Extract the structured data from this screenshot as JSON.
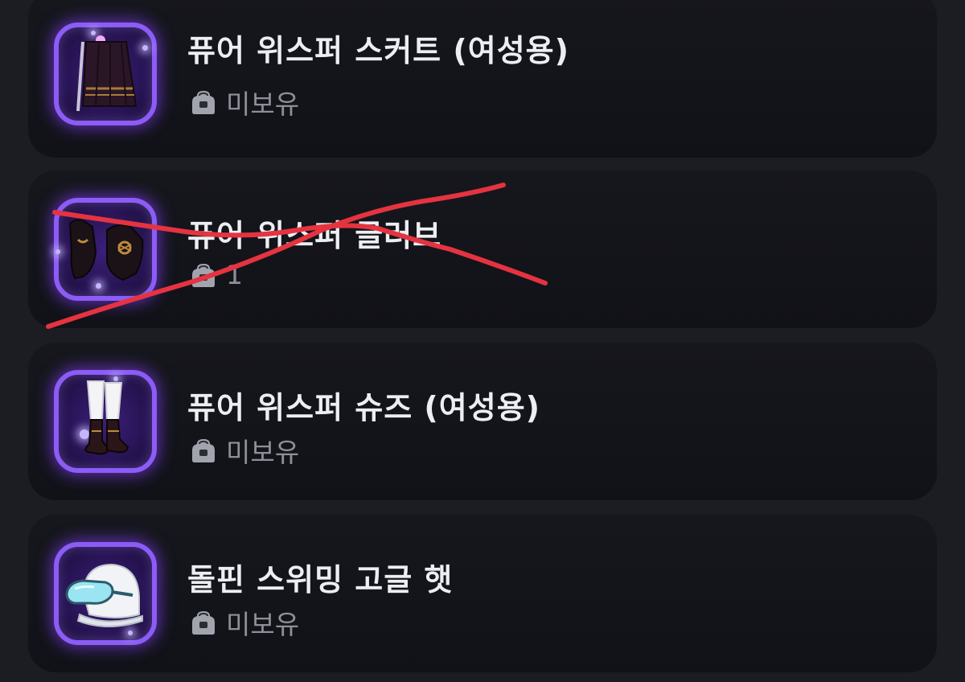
{
  "items": [
    {
      "name": "퓨어 위스퍼 스커트 (여성용)",
      "status": "미보유",
      "icon": "skirt-icon"
    },
    {
      "name": "퓨어 위스퍼 글러브",
      "status": "1",
      "icon": "gloves-icon",
      "crossed_out": true
    },
    {
      "name": "퓨어 위스퍼 슈즈 (여성용)",
      "status": "미보유",
      "icon": "shoes-icon"
    },
    {
      "name": "돌핀 스위밍 고글 햇",
      "status": "미보유",
      "icon": "goggle-hat-icon"
    }
  ],
  "status_icon": "backpack-icon",
  "colors": {
    "background": "#1b1d22",
    "card": "#14151b",
    "rarity_border": "#8b5cf6",
    "name_text": "#eceef2",
    "status_text": "#8d9099",
    "annotation_stroke": "#e53340"
  }
}
